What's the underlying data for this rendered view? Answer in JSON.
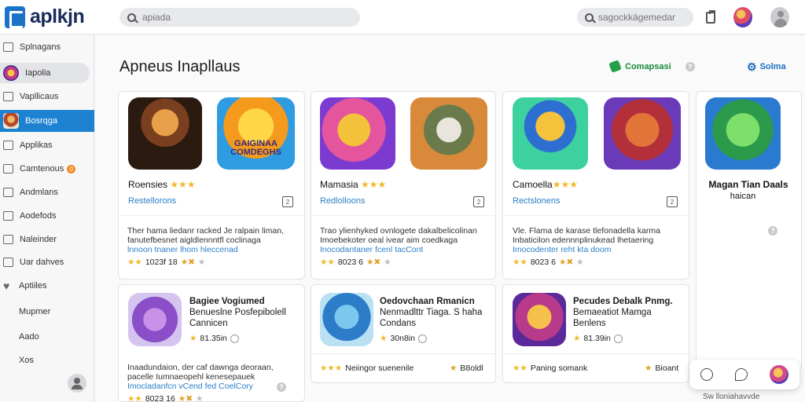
{
  "app": {
    "name": "aplkjn"
  },
  "search": {
    "placeholder": "apiada"
  },
  "search2": {
    "placeholder": "sagockkägemedar"
  },
  "sidebar": {
    "items": [
      {
        "label": "Splnagans"
      },
      {
        "label": "Iapolia"
      },
      {
        "label": "Vapllicaus"
      },
      {
        "label": "Bosrqga"
      },
      {
        "label": "Applikas"
      },
      {
        "label": "Camtenous",
        "badge": "0"
      },
      {
        "label": "Andmlans"
      },
      {
        "label": "Aodefods"
      },
      {
        "label": "Naleinder"
      },
      {
        "label": "Uar dahves"
      },
      {
        "label": "Aptiiles"
      },
      {
        "label": "Mupmer"
      },
      {
        "label": "Aado"
      },
      {
        "label": "Xos"
      }
    ]
  },
  "header": {
    "title": "Apneus Inapllaus",
    "compare_label": "Comapsasi",
    "settings_label": "Solma"
  },
  "cards": [
    {
      "name": "Roensies",
      "rating_stars": "★★★",
      "link": "Restellorons",
      "box": "2",
      "desc_lines": [
        "Ther hama liedanr racked Je ralpain liman,",
        "fanutefbesnet aigldlennntfl coclinaga"
      ],
      "desc_highlight": "lnnoon tnaner lhom hleccenad",
      "meta": "1023f 18",
      "img_text": "GAIGINAA COMDEGHS"
    },
    {
      "name": "Mamasia",
      "rating_stars": "★★★",
      "link": "Redlolloons",
      "box": "2",
      "desc_lines": [
        "Trao ylienhyked ovnlogete dakalbelicolinan",
        "Imoebekoter oeal ivear aim coedkaga"
      ],
      "desc_highlight": "Inocodantaner fcenl tacCont",
      "meta": "8023 6"
    },
    {
      "name": "Camoella",
      "rating_stars": "★★★",
      "link": "Rectslonens",
      "box": "2",
      "desc_lines": [
        "Vle. Flama de karase tlefonadella karma",
        "Inbaticilon edennnplinukead lhetaering"
      ],
      "desc_highlight": "Imocodenter reht kta doom",
      "meta": "8023 6"
    },
    {
      "name": "Magan Tian Daals",
      "sub": "haican"
    }
  ],
  "small_cards": [
    {
      "title_lines": [
        "Bagiee Vogiumed",
        "Benueslne Posfepibolell",
        "Cannicen"
      ],
      "meta": "81.35in",
      "desc_lines": [
        "Inaadundaion, der caf dawnga deoraan,",
        "pacelle Iumnaeopehl kenesepauek"
      ],
      "desc_highlight": "Imocladanfcn vCend fed CoelCory",
      "meta2": "8023 16"
    },
    {
      "title_lines": [
        "Oedovchaan Rmanicn",
        "Nenmadlttr Tiaga. S haha",
        "Condans"
      ],
      "meta": "30n8in",
      "bottom_left": "Neiingor suenenile",
      "bottom_right": "B8oldl"
    },
    {
      "title_lines": [
        "Pecudes Debalk Pnmg.",
        "Bemaeatiot Mamga",
        "Benlens"
      ],
      "meta": "81.39in",
      "bottom_left": "Paning somank",
      "bottom_right": "Bioant"
    }
  ],
  "footer_note": "Sw lloniahavvde"
}
